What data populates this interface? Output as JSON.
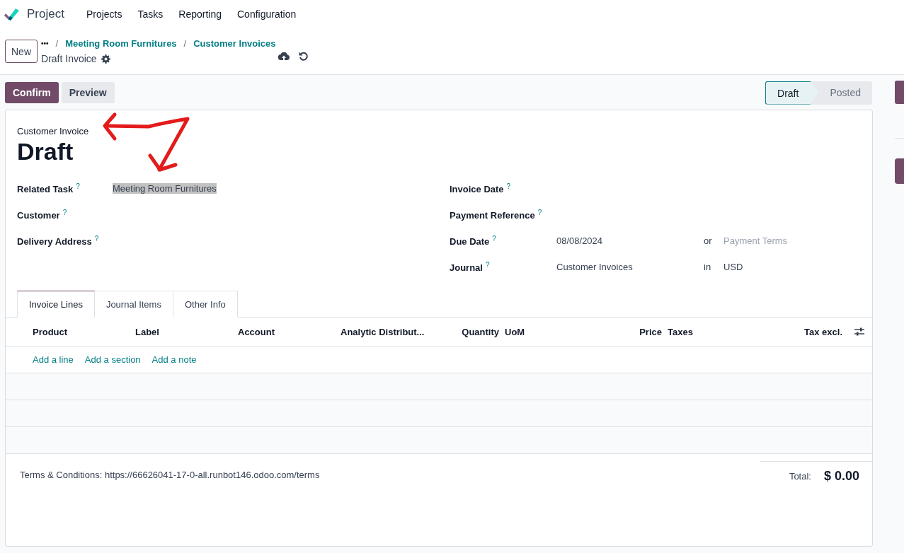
{
  "navbar": {
    "app_name": "Project",
    "menu": [
      "Projects",
      "Tasks",
      "Reporting",
      "Configuration"
    ]
  },
  "control_panel": {
    "new_button": "New",
    "breadcrumb_more": "•••",
    "breadcrumbs": [
      {
        "separator": "/",
        "label": "Meeting Room Furnitures"
      },
      {
        "separator": "/",
        "label": "Customer Invoices"
      }
    ],
    "record_title": "Draft Invoice"
  },
  "actions": {
    "buttons": [
      {
        "label": "Confirm",
        "kind": "primary"
      },
      {
        "label": "Preview",
        "kind": "secondary"
      }
    ],
    "statuses": [
      {
        "label": "Draft",
        "selected": true
      },
      {
        "label": "Posted",
        "selected": false
      }
    ]
  },
  "sheet": {
    "type_label": "Customer Invoice",
    "title": "Draft",
    "left_fields": [
      {
        "label": "Related Task",
        "help": "?",
        "value": "Meeting Room Furnitures",
        "highlighted": true
      },
      {
        "label": "Customer",
        "help": "?"
      },
      {
        "label": "Delivery Address",
        "help": "?"
      }
    ],
    "right_fields": [
      {
        "label": "Invoice Date",
        "help": "?"
      },
      {
        "label": "Payment Reference",
        "help": "?"
      },
      {
        "label": "Due Date",
        "help": "?",
        "value": "08/08/2024",
        "joiner": "or",
        "extra_placeholder": "Payment Terms"
      },
      {
        "label": "Journal",
        "help": "?",
        "value": "Customer Invoices",
        "joiner": "in",
        "extra": "USD"
      }
    ],
    "tabs": [
      {
        "label": "Invoice Lines",
        "selected": true
      },
      {
        "label": "Journal Items",
        "selected": false
      },
      {
        "label": "Other Info",
        "selected": false
      }
    ],
    "table": {
      "columns": [
        "Product",
        "Label",
        "Account",
        "Analytic Distribut...",
        "Quantity",
        "UoM",
        "Price",
        "Taxes",
        "Tax excl."
      ],
      "add_links": [
        "Add a line",
        "Add a section",
        "Add a note"
      ]
    },
    "terms": "Terms & Conditions: https://66626041-17-0-all.runbot146.odoo.com/terms",
    "total_label": "Total:",
    "total_value": "$ 0.00"
  }
}
